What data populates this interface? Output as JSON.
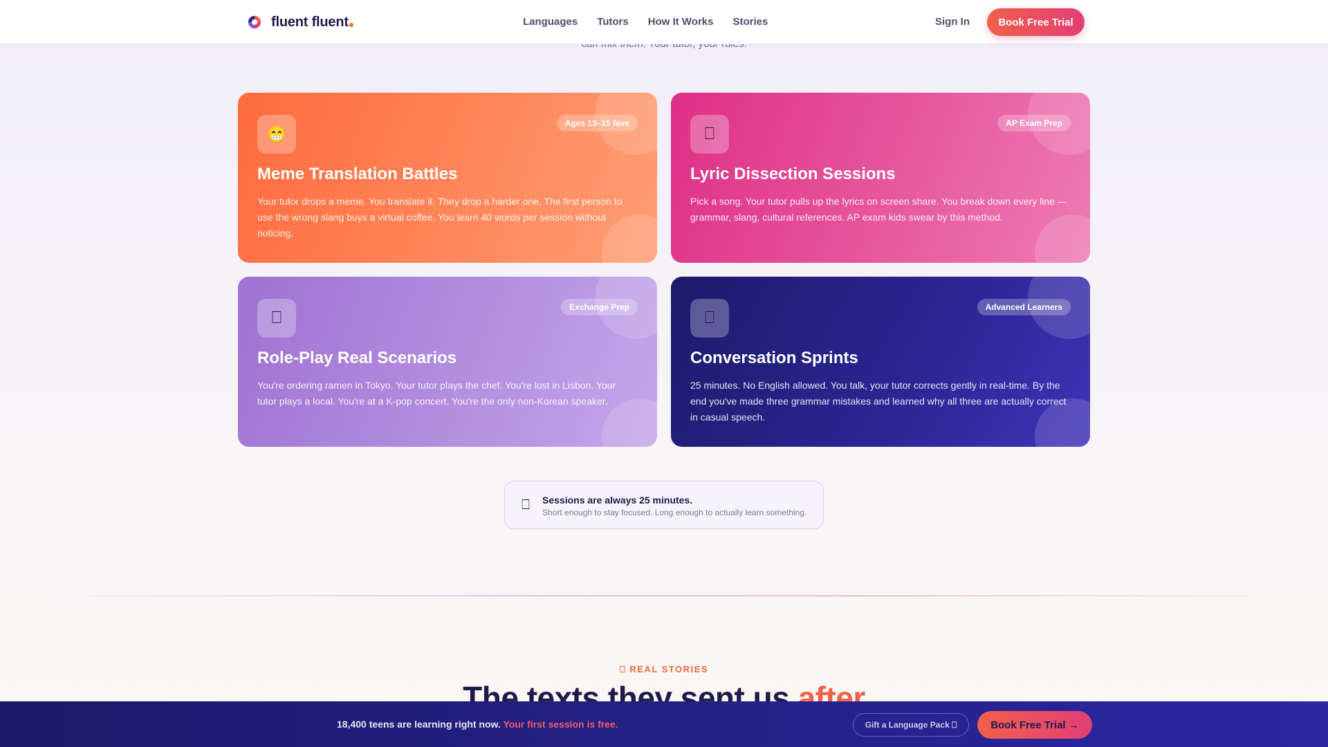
{
  "header": {
    "logo_text": "fluent fluent",
    "nav": [
      "Languages",
      "Tutors",
      "How It Works",
      "Stories"
    ],
    "sign_in": "Sign In",
    "cta": "Book Free Trial"
  },
  "hero_tail": "can mix them. Your tutor, your rules.",
  "cards": [
    {
      "icon": "😁",
      "icon_name": "grinning-face-icon",
      "badge": "Ages 13–15 fave",
      "title": "Meme Translation Battles",
      "desc": "Your tutor drops a meme. You translate it. They drop a harder one. The first person to use the wrong slang buys a virtual coffee. You learn 40 words per session without noticing."
    },
    {
      "icon": "⎕",
      "icon_name": "music-icon",
      "badge": "AP Exam Prep",
      "title": "Lyric Dissection Sessions",
      "desc": "Pick a song. Your tutor pulls up the lyrics on screen share. You break down every line — grammar, slang, cultural references. AP exam kids swear by this method."
    },
    {
      "icon": "⎕",
      "icon_name": "theater-icon",
      "badge": "Exchange Prep",
      "title": "Role-Play Real Scenarios",
      "desc": "You're ordering ramen in Tokyo. Your tutor plays the chef. You're lost in Lisbon. Your tutor plays a local. You're at a K-pop concert. You're the only non-Korean speaker."
    },
    {
      "icon": "⎕",
      "icon_name": "lightning-icon",
      "badge": "Advanced Learners",
      "title": "Conversation Sprints",
      "desc": "25 minutes. No English allowed. You talk, your tutor corrects gently in real-time. By the end you've made three grammar mistakes and learned why all three are actually correct in casual speech."
    }
  ],
  "session_note": {
    "icon": "⎕",
    "title": "Sessions are always 25 minutes.",
    "subtitle": "Short enough to stay focused. Long enough to actually learn something."
  },
  "stories": {
    "eyebrow": "⎕ REAL STORIES",
    "headline_main": "The texts they sent us",
    "headline_accent": "after"
  },
  "bottom_bar": {
    "text": "18,400 teens are learning right now.",
    "highlight": "Your first session is free.",
    "gift_button": "Gift a Language Pack ⎕",
    "cta": "Book Free Trial →"
  },
  "colors": {
    "brand_navy": "#1e1b4b",
    "cta_gradient_start": "#f2604a",
    "cta_gradient_end": "#e23e75",
    "card_orange": "#ff7a45",
    "card_pink": "#e33f92",
    "card_lavender": "#ad86dc",
    "card_indigo": "#24218a"
  }
}
